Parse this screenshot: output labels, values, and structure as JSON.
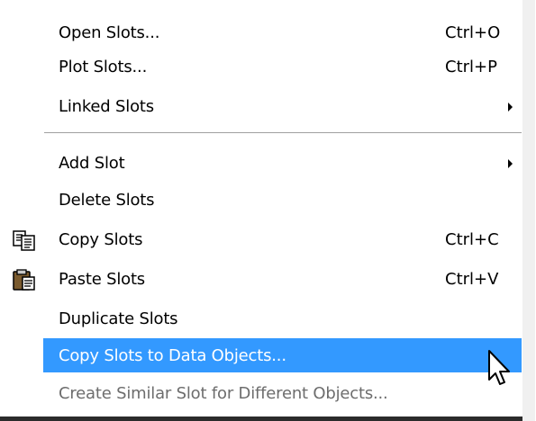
{
  "menu": {
    "items": [
      {
        "label": "Open Slots...",
        "shortcut": "Ctrl+O"
      },
      {
        "label": "Plot Slots...",
        "shortcut": "Ctrl+P"
      },
      {
        "label": "Linked Slots",
        "submenu": true
      },
      {
        "label": "Add Slot",
        "submenu": true
      },
      {
        "label": "Delete Slots"
      },
      {
        "label": "Copy Slots",
        "shortcut": "Ctrl+C",
        "icon": "copy-icon"
      },
      {
        "label": "Paste Slots",
        "shortcut": "Ctrl+V",
        "icon": "paste-icon"
      },
      {
        "label": "Duplicate Slots"
      },
      {
        "label": "Copy Slots to Data Objects...",
        "state": "highlighted"
      },
      {
        "label": "Create Similar Slot for Different Objects...",
        "state": "disabled"
      }
    ]
  },
  "colors": {
    "highlight": "#3399ff",
    "highlight_text": "#ffffff",
    "disabled_text": "#6d6d6d",
    "separator": "#a0a0a0"
  },
  "cursor": {
    "icon": "mouse-pointer-icon"
  }
}
